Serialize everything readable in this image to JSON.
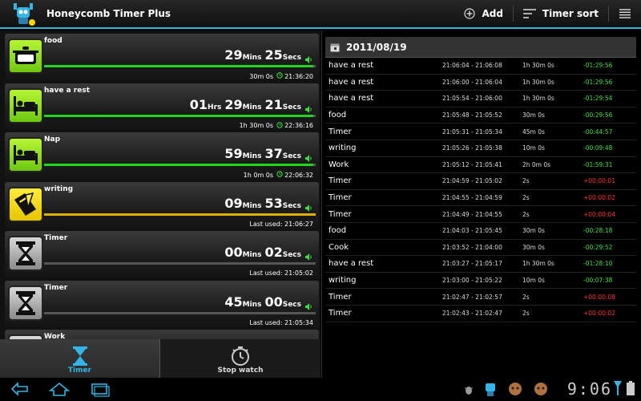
{
  "app": {
    "title": "Honeycomb Timer Plus"
  },
  "actions": {
    "add_label": "Add",
    "sort_label": "Timer sort"
  },
  "timers": [
    {
      "name": "food",
      "icon": "pot-icon",
      "style": "green",
      "time": [
        [
          "29",
          "Mins"
        ],
        [
          "25",
          "Secs"
        ]
      ],
      "progress": 0.99,
      "bar": "#1fd71f",
      "foot_left": "30m 0s",
      "foot_right": "21:36:20",
      "has_alarm": true
    },
    {
      "name": "have a rest",
      "icon": "bed-icon",
      "style": "green",
      "time": [
        [
          "01",
          "Hrs"
        ],
        [
          "29",
          "Mins"
        ],
        [
          "21",
          "Secs"
        ]
      ],
      "progress": 0.99,
      "bar": "#1fd71f",
      "foot_left": "1h 30m 0s",
      "foot_right": "22:36:16",
      "has_alarm": true
    },
    {
      "name": "Nap",
      "icon": "bed-icon",
      "style": "green",
      "time": [
        [
          "59",
          "Mins"
        ],
        [
          "37",
          "Secs"
        ]
      ],
      "progress": 0.99,
      "bar": "#1fd71f",
      "foot_left": "1h 0m 0s",
      "foot_right": "22:06:32",
      "has_alarm": true
    },
    {
      "name": "writing",
      "icon": "pen-icon",
      "style": "yellow",
      "time": [
        [
          "09",
          "Mins"
        ],
        [
          "53",
          "Secs"
        ]
      ],
      "progress": 1.0,
      "bar": "#e0b000",
      "foot_left": "Last used: 21:06:27",
      "foot_right": "",
      "has_alarm": false
    },
    {
      "name": "Timer",
      "icon": "hourglass-icon",
      "style": "grey",
      "time": [
        [
          "00",
          "Mins"
        ],
        [
          "02",
          "Secs"
        ]
      ],
      "progress": 0,
      "bar": "#888",
      "foot_left": "Last used: 21:05:02",
      "foot_right": "",
      "has_alarm": false
    },
    {
      "name": "Timer",
      "icon": "hourglass-icon",
      "style": "grey",
      "time": [
        [
          "45",
          "Mins"
        ],
        [
          "00",
          "Secs"
        ]
      ],
      "progress": 0,
      "bar": "#888",
      "foot_left": "Last used: 21:05:34",
      "foot_right": "",
      "has_alarm": false
    },
    {
      "name": "Work",
      "icon": "hourglass-icon",
      "style": "grey",
      "time": [],
      "progress": 0,
      "bar": "#888",
      "foot_left": "",
      "foot_right": "",
      "has_alarm": false
    }
  ],
  "tabs": {
    "timer_label": "Timer",
    "stopwatch_label": "Stop watch"
  },
  "log": {
    "date": "2011/08/19",
    "rows": [
      {
        "name": "have a rest",
        "range": "21:06:04 - 21:06:08",
        "duration": "1h 30m 0s",
        "diff": "-01:29:56",
        "color": "#3de13d"
      },
      {
        "name": "have a rest",
        "range": "21:06:00 - 21:06:04",
        "duration": "1h 30m 0s",
        "diff": "-01:29:56",
        "color": "#3de13d"
      },
      {
        "name": "have a rest",
        "range": "21:05:54 - 21:06:00",
        "duration": "1h 30m 0s",
        "diff": "-01:29:54",
        "color": "#3de13d"
      },
      {
        "name": "food",
        "range": "21:05:48 - 21:05:52",
        "duration": "30m 0s",
        "diff": "-00:29:56",
        "color": "#3de13d"
      },
      {
        "name": "Timer",
        "range": "21:05:31 - 21:05:34",
        "duration": "45m 0s",
        "diff": "-00:44:57",
        "color": "#3de13d"
      },
      {
        "name": "writing",
        "range": "21:05:26 - 21:05:38",
        "duration": "10m 0s",
        "diff": "-00:09:48",
        "color": "#3de13d"
      },
      {
        "name": "Work",
        "range": "21:05:12 - 21:05:41",
        "duration": "2h 0m 0s",
        "diff": "-01:59:31",
        "color": "#3de13d"
      },
      {
        "name": "Timer",
        "range": "21:04:59 - 21:05:02",
        "duration": "2s",
        "diff": "+00:00:01",
        "color": "#ff3333"
      },
      {
        "name": "Timer",
        "range": "21:04:55 - 21:04:59",
        "duration": "2s",
        "diff": "+00:00:02",
        "color": "#ff3333"
      },
      {
        "name": "Timer",
        "range": "21:04:49 - 21:04:55",
        "duration": "2s",
        "diff": "+00:00:04",
        "color": "#ff3333"
      },
      {
        "name": "food",
        "range": "21:04:03 - 21:05:45",
        "duration": "30m 0s",
        "diff": "-00:28:18",
        "color": "#3de13d"
      },
      {
        "name": "Cook",
        "range": "21:03:52 - 21:04:00",
        "duration": "30m 0s",
        "diff": "-00:29:52",
        "color": "#3de13d"
      },
      {
        "name": "have a rest",
        "range": "21:03:27 - 21:05:17",
        "duration": "1h 30m 0s",
        "diff": "-01:28:10",
        "color": "#3de13d"
      },
      {
        "name": "writing",
        "range": "21:03:00 - 21:05:22",
        "duration": "10m 0s",
        "diff": "-00:07:38",
        "color": "#3de13d"
      },
      {
        "name": "Timer",
        "range": "21:02:47 - 21:02:57",
        "duration": "2s",
        "diff": "+00:00:08",
        "color": "#ff3333"
      },
      {
        "name": "Timer",
        "range": "21:02:43 - 21:02:47",
        "duration": "2s",
        "diff": "+00:00:02",
        "color": "#ff3333"
      }
    ]
  },
  "system": {
    "clock": "9:06"
  },
  "colors": {
    "accent": "#33b5e5",
    "positive": "#3de13d",
    "negative": "#ff3333"
  }
}
